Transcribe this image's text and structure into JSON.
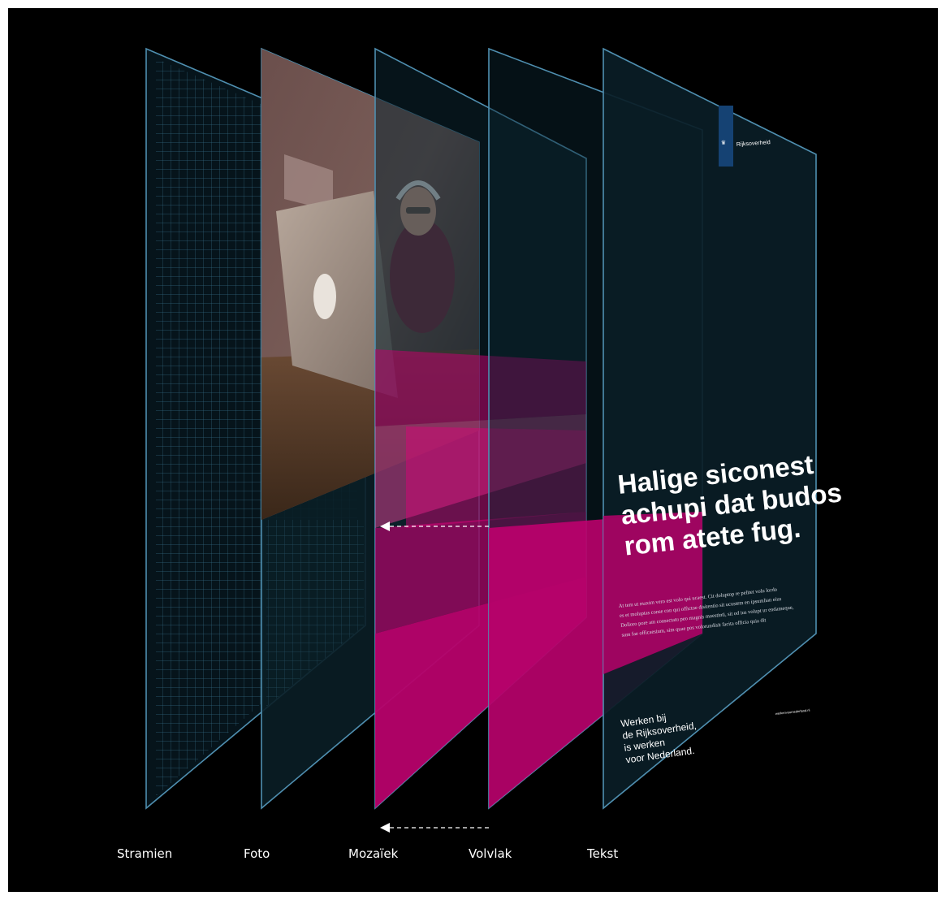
{
  "layers": [
    {
      "id": "stramien",
      "label": "Stramien"
    },
    {
      "id": "foto",
      "label": "Foto"
    },
    {
      "id": "mozaiek",
      "label": "Mozaïek"
    },
    {
      "id": "volvlak",
      "label": "Volvlak"
    },
    {
      "id": "tekst",
      "label": "Tekst"
    }
  ],
  "poster": {
    "logo_text": "Rijksoverheid",
    "headline": [
      "Halige siconest",
      "achupi dat budos",
      "rom atete fug."
    ],
    "body": [
      "At tem ut maxim vero est volo qui ucaest. Cit doluptop re pelitet volu lordo",
      "es et moluptas conse con qui offictoe disitentio sit ucustem en ipsumlian eius",
      "Dolloro pore am consectatu peo magnis moestinti, sit od ius volupt ur endameque,",
      "sum fae officaesium, sim quae pos volorundisit facita officia quia dit"
    ],
    "tagline": [
      "Werken bij",
      "de Rijksoverheid,",
      "is werken",
      "voor Nederland."
    ],
    "url": "werkenvoornederland.nl"
  },
  "colors": {
    "background": "#000000",
    "panel_edge": "#4f8fb0",
    "panel_fill": "#0b2530",
    "magenta": "#c0006e",
    "logo_blue": "#154273"
  }
}
